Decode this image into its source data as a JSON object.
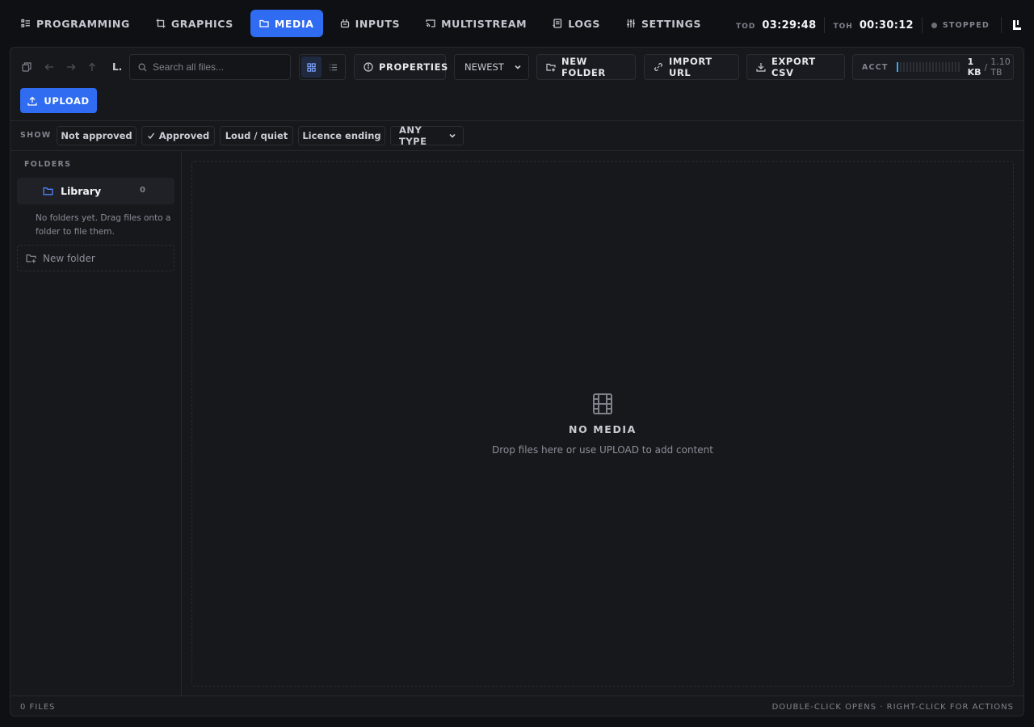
{
  "nav": {
    "tabs": [
      {
        "label": "PROGRAMMING",
        "icon": "list-icon"
      },
      {
        "label": "GRAPHICS",
        "icon": "frame-icon"
      },
      {
        "label": "MEDIA",
        "icon": "folder-icon",
        "active": true
      },
      {
        "label": "INPUTS",
        "icon": "input-icon"
      },
      {
        "label": "MULTISTREAM",
        "icon": "cast-icon"
      },
      {
        "label": "LOGS",
        "icon": "log-icon"
      },
      {
        "label": "SETTINGS",
        "icon": "sliders-icon"
      }
    ]
  },
  "status": {
    "tod_label": "TOD",
    "tod_value": "03:29:48",
    "toh_label": "TOH",
    "toh_value": "00:30:12",
    "state": "STOPPED"
  },
  "toolbar": {
    "breadcrumb": "L.",
    "search_placeholder": "Search all files...",
    "properties_label": "PROPERTIES",
    "sort_value": "NEWEST",
    "new_folder_label": "NEW FOLDER",
    "import_url_label": "IMPORT URL",
    "export_csv_label": "EXPORT CSV",
    "acct_label": "ACCT",
    "acct_used": "1 KB",
    "acct_sep": "/",
    "acct_total": "1.10 TB",
    "acct_usage_fraction": 0.02,
    "upload_label": "UPLOAD"
  },
  "filters": {
    "show_label": "SHOW",
    "chips": [
      "Not approved",
      "Approved",
      "Loud / quiet",
      "Licence ending"
    ],
    "type_select": "ANY TYPE"
  },
  "sidebar": {
    "title": "FOLDERS",
    "library_name": "Library",
    "library_count": "0",
    "hint": "No folders yet. Drag files onto a folder to file them.",
    "new_folder_label": "New folder"
  },
  "content": {
    "empty_title": "NO MEDIA",
    "empty_hint": "Drop files here or use UPLOAD to add content"
  },
  "footer": {
    "file_count": "0 FILES",
    "hint": "DOUBLE-CLICK OPENS · RIGHT-CLICK FOR ACTIONS"
  },
  "colors": {
    "accent": "#2f6cf2",
    "background": "#0f1014",
    "panel": "#17181c",
    "usage_fill": "#3ba7f5"
  }
}
